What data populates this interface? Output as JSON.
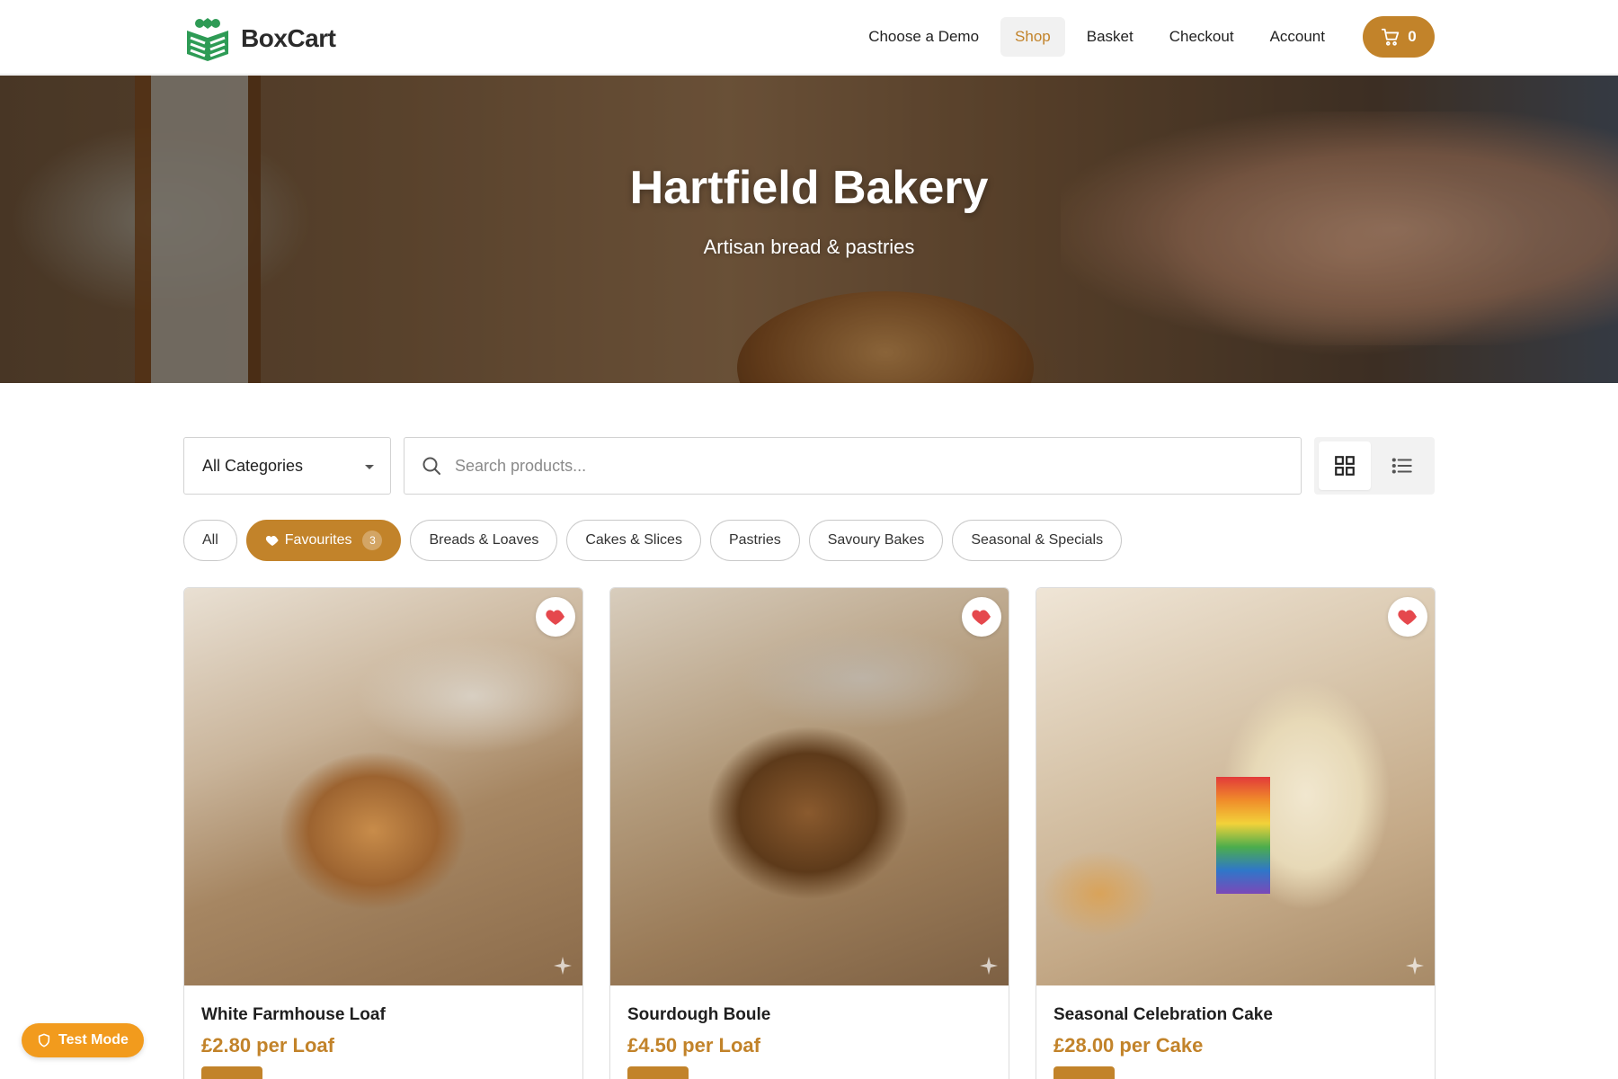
{
  "brand": {
    "name": "BoxCart"
  },
  "nav": {
    "items": [
      {
        "label": "Choose a Demo",
        "active": false
      },
      {
        "label": "Shop",
        "active": true
      },
      {
        "label": "Basket",
        "active": false
      },
      {
        "label": "Checkout",
        "active": false
      },
      {
        "label": "Account",
        "active": false
      }
    ],
    "cart_count": "0"
  },
  "hero": {
    "title": "Hartfield Bakery",
    "subtitle": "Artisan bread & pastries"
  },
  "toolbar": {
    "category_selected": "All Categories",
    "search_placeholder": "Search products...",
    "view_modes": [
      "grid-icon",
      "list-icon"
    ],
    "active_view": "grid"
  },
  "filters": {
    "chips": [
      {
        "label": "All",
        "active": false
      },
      {
        "label": "Favourites",
        "active": true,
        "count": "3"
      },
      {
        "label": "Breads & Loaves",
        "active": false
      },
      {
        "label": "Cakes & Slices",
        "active": false
      },
      {
        "label": "Pastries",
        "active": false
      },
      {
        "label": "Savoury Bakes",
        "active": false
      },
      {
        "label": "Seasonal & Specials",
        "active": false
      }
    ]
  },
  "products": [
    {
      "name": "White Farmhouse Loaf",
      "price": "£2.80 per Loaf",
      "favourite": true
    },
    {
      "name": "Sourdough Boule",
      "price": "£4.50 per Loaf",
      "favourite": true
    },
    {
      "name": "Seasonal Celebration Cake",
      "price": "£28.00 per Cake",
      "favourite": true
    }
  ],
  "test_mode": {
    "label": "Test Mode"
  },
  "colors": {
    "accent": "#c2832a",
    "favourite": "#e5484d",
    "test_mode": "#f29b1d"
  }
}
